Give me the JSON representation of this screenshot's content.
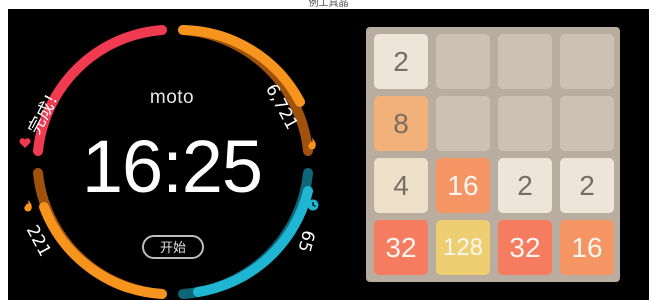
{
  "caption": "例工具晶",
  "watch": {
    "brand": "moto",
    "time": "16:25",
    "start_button": "开始",
    "label_completed": "完成！",
    "label_steps": "6,721",
    "label_calories": "221",
    "label_heart": "65"
  },
  "game": {
    "tiles": [
      {
        "value": "2",
        "row": 0,
        "col": 0,
        "bg": "#eee4da",
        "fg": "#776e65"
      },
      {
        "value": "",
        "row": 0,
        "col": 1,
        "bg": "#cdc1b4",
        "fg": "#776e65"
      },
      {
        "value": "",
        "row": 0,
        "col": 2,
        "bg": "#cdc1b4",
        "fg": "#776e65"
      },
      {
        "value": "",
        "row": 0,
        "col": 3,
        "bg": "#cdc1b4",
        "fg": "#776e65"
      },
      {
        "value": "8",
        "row": 1,
        "col": 0,
        "bg": "#f2b179",
        "fg": "#776e65"
      },
      {
        "value": "",
        "row": 1,
        "col": 1,
        "bg": "#cdc1b4",
        "fg": "#776e65"
      },
      {
        "value": "",
        "row": 1,
        "col": 2,
        "bg": "#cdc1b4",
        "fg": "#776e65"
      },
      {
        "value": "",
        "row": 1,
        "col": 3,
        "bg": "#cdc1b4",
        "fg": "#776e65"
      },
      {
        "value": "4",
        "row": 2,
        "col": 0,
        "bg": "#ede0c8",
        "fg": "#776e65"
      },
      {
        "value": "16",
        "row": 2,
        "col": 1,
        "bg": "#f59563",
        "fg": "#f9f6f2"
      },
      {
        "value": "2",
        "row": 2,
        "col": 2,
        "bg": "#eee4da",
        "fg": "#776e65"
      },
      {
        "value": "2",
        "row": 2,
        "col": 3,
        "bg": "#eee4da",
        "fg": "#776e65"
      },
      {
        "value": "32",
        "row": 3,
        "col": 0,
        "bg": "#f67c5f",
        "fg": "#f9f6f2"
      },
      {
        "value": "128",
        "row": 3,
        "col": 1,
        "bg": "#edcf72",
        "fg": "#f9f6f2"
      },
      {
        "value": "32",
        "row": 3,
        "col": 2,
        "bg": "#f67c5f",
        "fg": "#f9f6f2"
      },
      {
        "value": "16",
        "row": 3,
        "col": 3,
        "bg": "#f59563",
        "fg": "#f9f6f2"
      }
    ]
  },
  "colors": {
    "ring_red": "#ef3a50",
    "ring_orange": "#f7941d",
    "ring_orange_dark": "#a0520c",
    "ring_teal": "#1fb6d4",
    "ring_teal_dark": "#0e6678"
  }
}
